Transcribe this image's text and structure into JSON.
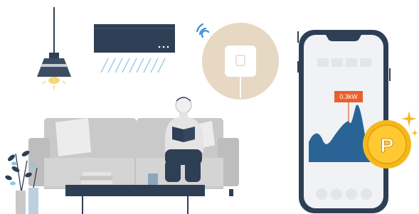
{
  "illustration": {
    "phone": {
      "power_reading": "0.3kW",
      "badge_letter": "P"
    },
    "colors": {
      "navy": "#2e3f55",
      "sofa_gray": "#c9c9c9",
      "wifi_blue": "#3a8fd6",
      "hub_tan": "#e6d8c2",
      "chart_blue": "#2a6496",
      "accent_orange": "#e8602c",
      "coin_gold": "#f5b81c",
      "lamp_glow": "#f7d777"
    },
    "icons": [
      "pendant-lamp-icon",
      "air-conditioner-icon",
      "wifi-signal-icon",
      "smart-plug-hub-icon",
      "smartphone-icon",
      "points-coin-icon",
      "sparkle-icon",
      "plant-icon"
    ]
  }
}
